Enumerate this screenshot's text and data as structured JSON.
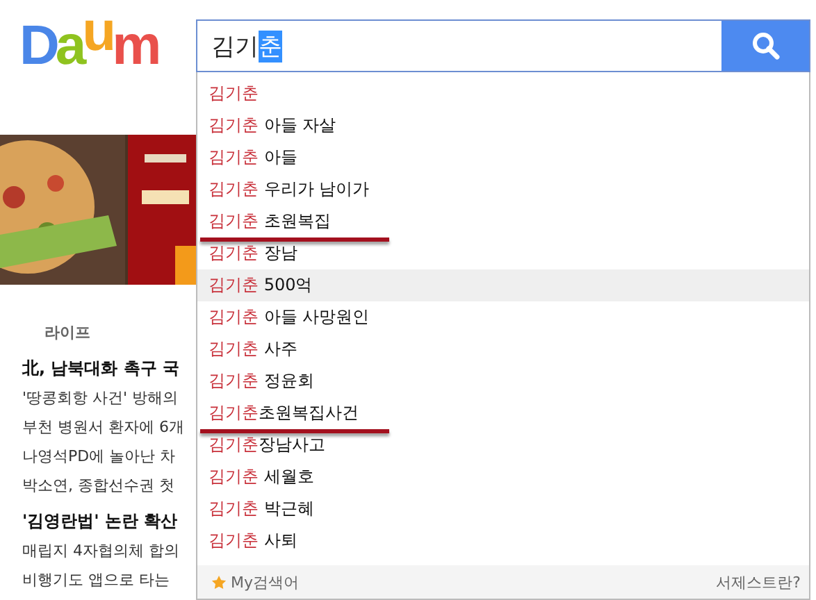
{
  "logo": {
    "letters": [
      {
        "char": "D",
        "color": "#4a86e8"
      },
      {
        "char": "a",
        "color": "#8fc31f"
      },
      {
        "char": "u",
        "color": "#f5a623"
      },
      {
        "char": "m",
        "color": "#e9504b"
      }
    ]
  },
  "search": {
    "typed": "김기",
    "selected_part": "춘"
  },
  "nav": {
    "label": "라이프"
  },
  "news": [
    {
      "text": "北, 남북대화 촉구 국",
      "bold": true
    },
    {
      "text": "'땅콩회항 사건' 방해의",
      "bold": false
    },
    {
      "text": "부천 병원서 환자에 6개",
      "bold": false
    },
    {
      "text": "나영석PD에 놀아난 차",
      "bold": false
    },
    {
      "text": "박소연, 종합선수권 첫",
      "bold": false
    },
    {
      "text": "'김영란법' 논란 확산",
      "bold": true
    },
    {
      "text": "매립지 4자협의체 합의",
      "bold": false
    },
    {
      "text": "비행기도 앱으로 타는",
      "bold": false
    }
  ],
  "suggestions": [
    {
      "match": "김기춘",
      "selected": false,
      "underlined": false
    },
    {
      "match": "김기춘",
      "rest": " 아들 자살",
      "selected": false,
      "underlined": false
    },
    {
      "match": "김기춘",
      "rest": " 아들",
      "selected": false,
      "underlined": false
    },
    {
      "match": "김기춘",
      "rest": " 우리가 남이가",
      "selected": false,
      "underlined": false
    },
    {
      "match": "김기춘",
      "rest": " 초원복집",
      "selected": false,
      "underlined": true
    },
    {
      "match": "김기춘",
      "rest": " 장남",
      "selected": false,
      "underlined": false
    },
    {
      "match": "김기춘",
      "rest": " 500억",
      "selected": true,
      "underlined": false
    },
    {
      "match": "김기춘",
      "rest": " 아들 사망원인",
      "selected": false,
      "underlined": false
    },
    {
      "match": "김기춘",
      "rest": " 사주",
      "selected": false,
      "underlined": false
    },
    {
      "match": "김기춘",
      "rest": " 정윤회",
      "selected": false,
      "underlined": false
    },
    {
      "match": "김기춘",
      "rest": "초원복집사건",
      "selected": false,
      "underlined": true
    },
    {
      "match": "김기춘",
      "rest": "장남사고",
      "selected": false,
      "underlined": false
    },
    {
      "match": "김기춘",
      "rest": " 세월호",
      "selected": false,
      "underlined": false
    },
    {
      "match": "김기춘",
      "rest": " 박근혜",
      "selected": false,
      "underlined": false
    },
    {
      "match": "김기춘",
      "rest": " 사퇴",
      "selected": false,
      "underlined": false
    }
  ],
  "footer": {
    "my_keywords": "My검색어",
    "help_link": "서제스트란?"
  }
}
